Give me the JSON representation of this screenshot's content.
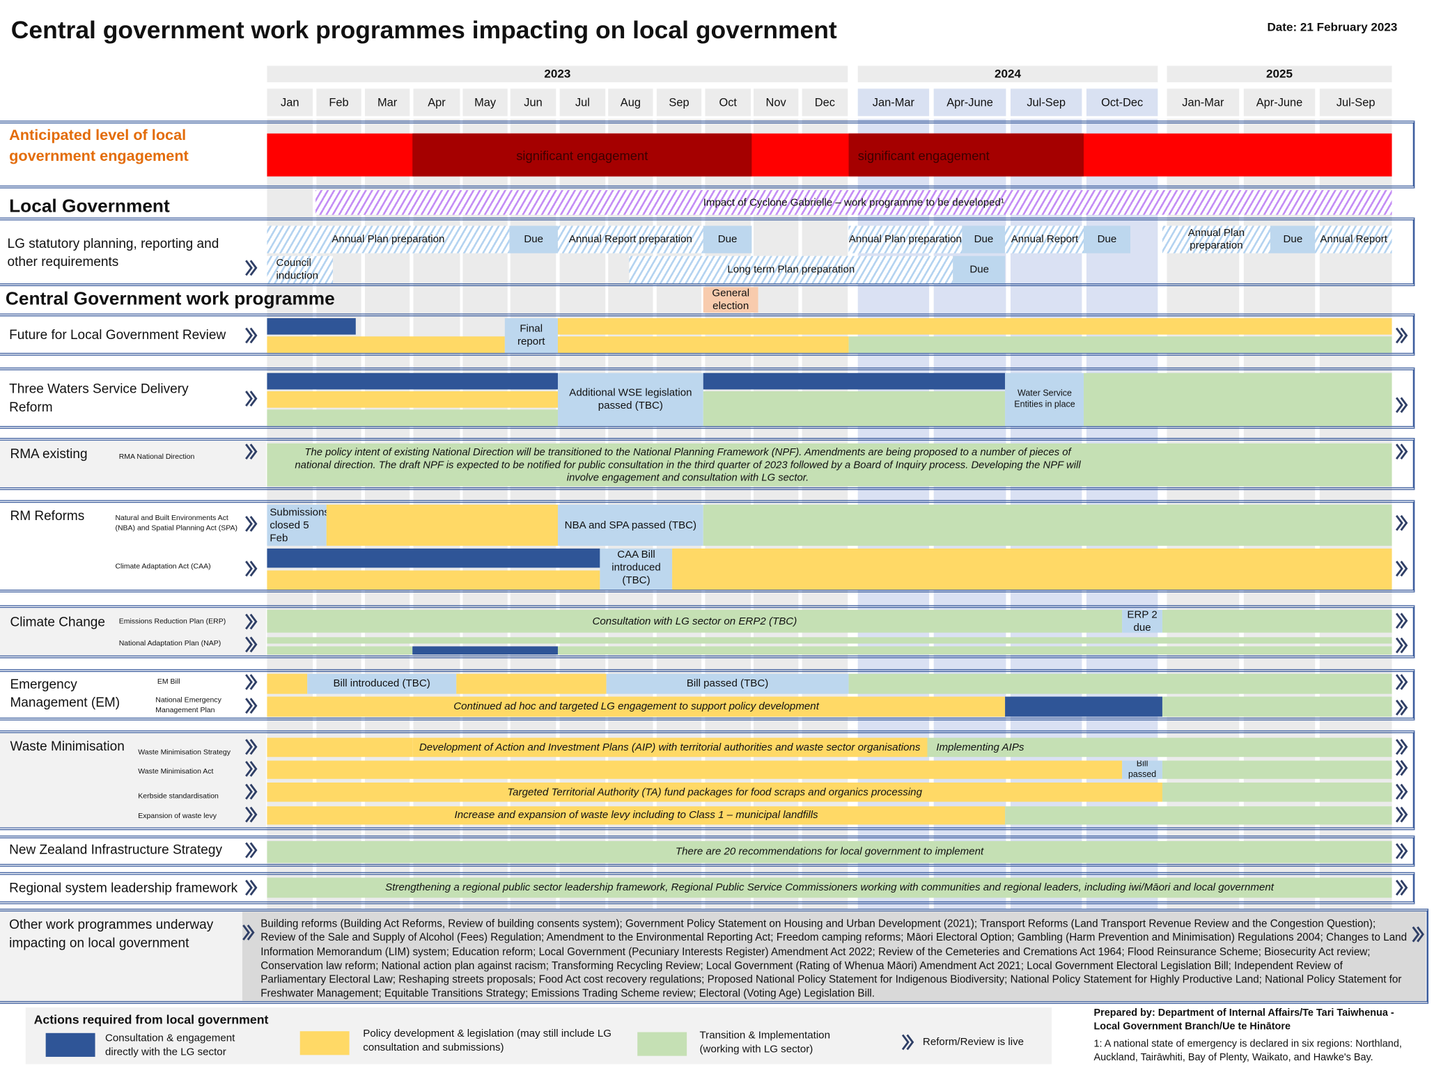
{
  "header": {
    "title": "Central government work programmes impacting on local government",
    "date": "Date: 21 February 2023"
  },
  "timeline": {
    "years": [
      "2023",
      "2024",
      "2025"
    ],
    "columns": [
      "Jan",
      "Feb",
      "Mar",
      "Apr",
      "May",
      "Jun",
      "Jul",
      "Aug",
      "Sep",
      "Oct",
      "Nov",
      "Dec",
      "Jan-Mar",
      "Apr-June",
      "Jul-Sep",
      "Oct-Dec",
      "Jan-Mar",
      "Apr-June",
      "Jul-Sep"
    ]
  },
  "colors": {
    "consultation": "#2f5597",
    "policy": "#ffd966",
    "transition": "#c5e0b4",
    "milestone": "#bdd7ee",
    "high": "#ff0000",
    "significant": "#a50000",
    "election": "#f8cbad",
    "hatch_blue": "#b4d3f0",
    "hatch_purple": "#c48ef5",
    "label_orange": "#e36c09",
    "border": "#3d5e9e",
    "stripe_grey": "#ebebeb",
    "stripe_blue": "#dae1f3"
  },
  "headings": {
    "local_government": "Local Government",
    "central_government": "Central Government work programme"
  },
  "sections": [
    {
      "id": "engagement",
      "label": "Anticipated level of local government engagement",
      "sublabels": [],
      "bars": [
        {
          "track": 0,
          "start": "2023-01-01",
          "end": "2025-10-01",
          "type": "high",
          "label": ""
        },
        {
          "track": 0,
          "start": "2023-04-01",
          "end": "2023-11-01",
          "type": "significant",
          "label": "significant engagement"
        },
        {
          "track": 0,
          "start": "2024-01-01",
          "end": "2024-10-01",
          "type": "significant",
          "label": "significant engagement",
          "align": "left"
        }
      ]
    },
    {
      "id": "cyclone",
      "label": "",
      "sublabels": [],
      "bars": [
        {
          "track": 0,
          "start": "2023-02-01",
          "end": "2025-10-01",
          "type": "hatch_purple",
          "label": "Impact of Cyclone Gabrielle – work programme to be developed¹"
        }
      ]
    },
    {
      "id": "statutory",
      "label": "LG statutory planning, reporting and other requirements",
      "sublabels": [],
      "bars": [
        {
          "track": 0,
          "start": "2023-01-01",
          "end": "2023-06-01",
          "type": "hatch_blue",
          "label": "Annual Plan preparation"
        },
        {
          "track": 0,
          "start": "2023-06-01",
          "end": "2023-07-01",
          "type": "milestone",
          "label": "Due"
        },
        {
          "track": 0,
          "start": "2023-07-01",
          "end": "2023-10-01",
          "type": "hatch_blue",
          "label": "Annual Report preparation"
        },
        {
          "track": 0,
          "start": "2023-10-01",
          "end": "2023-11-01",
          "type": "milestone",
          "label": "Due"
        },
        {
          "track": 0,
          "start": "2024-01-01",
          "end": "2024-05-11",
          "type": "hatch_blue",
          "label": "Annual Plan preparation"
        },
        {
          "track": 0,
          "start": "2024-05-11",
          "end": "2024-07-01",
          "type": "milestone",
          "label": "Due"
        },
        {
          "track": 0,
          "start": "2024-07-01",
          "end": "2024-10-01",
          "type": "hatch_blue",
          "label": "Annual Report"
        },
        {
          "track": 0,
          "start": "2024-10-01",
          "end": "2024-11-24",
          "type": "milestone",
          "label": "Due"
        },
        {
          "track": 0,
          "start": "2025-01-01",
          "end": "2025-05-08",
          "type": "hatch_blue",
          "label": "Annual Plan preparation"
        },
        {
          "track": 0,
          "start": "2025-05-08",
          "end": "2025-07-01",
          "type": "milestone",
          "label": "Due"
        },
        {
          "track": 0,
          "start": "2025-07-01",
          "end": "2025-10-01",
          "type": "hatch_blue",
          "label": "Annual Report"
        },
        {
          "track": 1,
          "start": "2023-01-01",
          "end": "2023-02-12",
          "type": "hatch_blue",
          "label": "Council induction",
          "align": "left"
        },
        {
          "track": 1,
          "start": "2023-08-15",
          "end": "2024-05-01",
          "type": "hatch_blue",
          "label": "Long term Plan preparation"
        },
        {
          "track": 1,
          "start": "2024-05-01",
          "end": "2024-07-01",
          "type": "milestone",
          "label": "Due"
        }
      ]
    },
    {
      "id": "election",
      "label": "",
      "sublabels": [],
      "bars": [
        {
          "track": 0,
          "start": "2023-10-01",
          "end": "2023-11-05",
          "type": "election",
          "label": "General election"
        }
      ]
    },
    {
      "id": "future",
      "label": "Future for Local Government Review",
      "sublabels": [],
      "bars": [
        {
          "track": 0,
          "start": "2023-01-01",
          "end": "2023-02-26",
          "type": "consultation",
          "label": ""
        },
        {
          "track": 1,
          "start": "2023-01-01",
          "end": "2023-05-28",
          "type": "policy",
          "label": ""
        },
        {
          "track": 0,
          "span": 2,
          "start": "2023-05-28",
          "end": "2023-07-01",
          "type": "milestone",
          "label": "Final report"
        },
        {
          "track": 0,
          "start": "2023-07-01",
          "end": "2025-10-01",
          "type": "policy",
          "label": ""
        },
        {
          "track": 1,
          "start": "2023-07-01",
          "end": "2024-01-01",
          "type": "policy",
          "label": ""
        },
        {
          "track": 1,
          "start": "2024-01-01",
          "end": "2025-10-01",
          "type": "transition",
          "label": ""
        }
      ]
    },
    {
      "id": "water",
      "label": "Three Waters Service Delivery Reform",
      "sublabels": [],
      "bars": [
        {
          "track": 0,
          "start": "2023-01-01",
          "end": "2023-07-01",
          "type": "consultation",
          "label": ""
        },
        {
          "track": 1,
          "start": "2023-01-01",
          "end": "2023-07-01",
          "type": "policy",
          "label": ""
        },
        {
          "track": 2,
          "start": "2023-01-01",
          "end": "2023-07-01",
          "type": "transition",
          "label": ""
        },
        {
          "track": 0,
          "span": 3,
          "start": "2023-07-01",
          "end": "2023-10-01",
          "type": "milestone",
          "label": "Additional WSE legislation passed (TBC)"
        },
        {
          "track": 0,
          "start": "2023-10-01",
          "end": "2024-07-01",
          "type": "consultation",
          "label": ""
        },
        {
          "track": 1,
          "span": 2,
          "start": "2023-10-01",
          "end": "2024-07-01",
          "type": "transition",
          "label": ""
        },
        {
          "track": 0,
          "span": 3,
          "start": "2024-07-01",
          "end": "2024-10-01",
          "type": "milestone",
          "label": "Water Service Entities in place",
          "small": true
        },
        {
          "track": 0,
          "span": 3,
          "start": "2024-10-01",
          "end": "2025-10-01",
          "type": "transition",
          "label": ""
        }
      ]
    },
    {
      "id": "rma",
      "label": "RMA existing",
      "sublabels": [
        "RMA National Direction"
      ],
      "bars": [
        {
          "track": 0,
          "start": "2023-01-01",
          "end": "2025-10-01",
          "type": "transition",
          "italic": true,
          "label": "The policy intent of existing National Direction will be transitioned to the National Planning Framework (NPF). Amendments are being proposed to a number of pieces of national direction. The draft NPF is expected to be notified for public consultation in the third quarter of 2023 followed by a Board of Inquiry process. Developing the NPF will involve engagement and consultation with LG sector."
        }
      ]
    },
    {
      "id": "rm",
      "label": "RM Reforms",
      "sublabels": [
        "Natural and Built Environments Act (NBA) and Spatial Planning Act (SPA)",
        "Climate Adaptation Act (CAA)"
      ],
      "bars": [
        {
          "track": 0,
          "start": "2023-01-01",
          "end": "2023-02-08",
          "type": "milestone",
          "label": "Submissions closed 5 Feb",
          "align": "left"
        },
        {
          "track": 0,
          "start": "2023-02-08",
          "end": "2023-07-01",
          "type": "policy",
          "label": ""
        },
        {
          "track": 0,
          "start": "2023-07-01",
          "end": "2023-10-01",
          "type": "milestone",
          "label": "NBA and SPA passed (TBC)"
        },
        {
          "track": 0,
          "start": "2023-10-01",
          "end": "2025-10-01",
          "type": "transition",
          "label": ""
        },
        {
          "track": 1,
          "start": "2023-01-01",
          "end": "2023-07-27",
          "type": "consultation",
          "label": ""
        },
        {
          "track": 2,
          "start": "2023-01-01",
          "end": "2023-07-27",
          "type": "policy",
          "label": ""
        },
        {
          "track": 1,
          "span": 2,
          "start": "2023-07-27",
          "end": "2023-09-12",
          "type": "milestone",
          "label": "CAA Bill introduced (TBC)"
        },
        {
          "track": 1,
          "span": 2,
          "start": "2023-09-12",
          "end": "2025-10-01",
          "type": "policy",
          "label": ""
        }
      ]
    },
    {
      "id": "climate",
      "label": "Climate Change",
      "sublabels": [
        "Emissions Reduction Plan (ERP)",
        "National Adaptation Plan (NAP)"
      ],
      "bars": [
        {
          "track": 0,
          "start": "2023-01-01",
          "end": "2024-11-15",
          "type": "transition",
          "italic": true,
          "label": "Consultation with LG sector on ERP2 (TBC)"
        },
        {
          "track": 0,
          "start": "2024-11-15",
          "end": "2025-01-01",
          "type": "milestone",
          "label": "ERP 2 due"
        },
        {
          "track": 0,
          "start": "2025-01-01",
          "end": "2025-10-01",
          "type": "transition",
          "label": ""
        },
        {
          "track": 1,
          "start": "2023-01-01",
          "end": "2025-10-01",
          "type": "transition",
          "label": ""
        },
        {
          "track": 2,
          "start": "2023-01-01",
          "end": "2023-04-01",
          "type": "transition",
          "label": ""
        },
        {
          "track": 2,
          "start": "2023-04-01",
          "end": "2023-07-01",
          "type": "consultation",
          "label": ""
        },
        {
          "track": 2,
          "start": "2023-07-01",
          "end": "2025-10-01",
          "type": "transition",
          "label": ""
        }
      ]
    },
    {
      "id": "em",
      "label": "Emergency Management (EM)",
      "sublabels": [
        "EM Bill",
        "National Emergency Management Plan"
      ],
      "bars": [
        {
          "track": 0,
          "start": "2023-01-01",
          "end": "2023-01-26",
          "type": "policy",
          "label": ""
        },
        {
          "track": 0,
          "start": "2023-01-26",
          "end": "2023-04-28",
          "type": "milestone",
          "label": "Bill introduced (TBC)"
        },
        {
          "track": 0,
          "start": "2023-04-28",
          "end": "2023-08-01",
          "type": "policy",
          "label": ""
        },
        {
          "track": 0,
          "start": "2023-08-01",
          "end": "2024-01-01",
          "type": "milestone",
          "label": "Bill passed (TBC)"
        },
        {
          "track": 0,
          "start": "2024-01-01",
          "end": "2025-10-01",
          "type": "transition",
          "label": ""
        },
        {
          "track": 1,
          "start": "2023-01-01",
          "end": "2024-07-01",
          "type": "policy",
          "italic": true,
          "label": "Continued ad hoc and targeted LG engagement to support policy development"
        },
        {
          "track": 1,
          "start": "2024-07-01",
          "end": "2025-01-01",
          "type": "consultation",
          "label": ""
        },
        {
          "track": 1,
          "start": "2025-01-01",
          "end": "2025-10-01",
          "type": "transition",
          "label": ""
        }
      ]
    },
    {
      "id": "waste",
      "label": "Waste Minimisation",
      "sublabels": [
        "Waste Minimisation Strategy",
        "Waste Minimisation Act",
        "Kerbside standardisation",
        "Expansion of waste levy"
      ],
      "bars": [
        {
          "track": 0,
          "start": "2023-01-01",
          "end": "2023-04-01",
          "type": "policy",
          "label": ""
        },
        {
          "track": 0,
          "start": "2023-04-01",
          "end": "2024-04-01",
          "type": "policy",
          "italic": true,
          "label": "Development of Action and Investment Plans (AIP) with territorial authorities and waste sector organisations"
        },
        {
          "track": 0,
          "start": "2024-04-01",
          "end": "2025-10-01",
          "type": "transition",
          "italic": true,
          "label": "Implementing AIPs",
          "align": "left"
        },
        {
          "track": 1,
          "start": "2023-01-01",
          "end": "2024-11-15",
          "type": "policy",
          "label": ""
        },
        {
          "track": 1,
          "start": "2024-11-15",
          "end": "2025-01-01",
          "type": "milestone",
          "label": "Bill passed",
          "small": true
        },
        {
          "track": 1,
          "start": "2025-01-01",
          "end": "2025-10-01",
          "type": "transition",
          "label": ""
        },
        {
          "track": 2,
          "start": "2023-01-01",
          "end": "2025-01-01",
          "type": "policy",
          "italic": true,
          "label": "Targeted Territorial Authority (TA) fund packages for food scraps and organics processing"
        },
        {
          "track": 2,
          "start": "2025-01-01",
          "end": "2025-10-01",
          "type": "transition",
          "label": ""
        },
        {
          "track": 3,
          "start": "2023-01-01",
          "end": "2024-07-01",
          "type": "policy",
          "italic": true,
          "label": "Increase and expansion of waste levy including to Class 1 – municipal landfills"
        },
        {
          "track": 3,
          "start": "2024-07-01",
          "end": "2025-10-01",
          "type": "transition",
          "label": ""
        }
      ]
    },
    {
      "id": "nzis",
      "label": "New Zealand Infrastructure Strategy",
      "sublabels": [],
      "bars": [
        {
          "track": 0,
          "start": "2023-01-01",
          "end": "2025-10-01",
          "type": "transition",
          "italic": true,
          "label": "There are 20 recommendations for local government to implement"
        }
      ]
    },
    {
      "id": "regional",
      "label": "Regional system leadership framework",
      "sublabels": [],
      "bars": [
        {
          "track": 0,
          "start": "2023-01-01",
          "end": "2025-10-01",
          "type": "transition",
          "italic": true,
          "label": "Strengthening a regional public sector leadership framework, Regional Public Service Commissioners working with communities and regional leaders, including iwi/Māori and local government"
        }
      ]
    }
  ],
  "other": {
    "label": "Other work programmes underway impacting on local government",
    "text": "Building reforms (Building Act Reforms, Review of building consents system); Government Policy Statement on Housing and Urban Development (2021); Transport Reforms (Land Transport Revenue Review and the Congestion Question); Review of the Sale and Supply of Alcohol (Fees) Regulation; Amendment to the Environmental Reporting Act; Freedom camping reforms;  Māori Electoral Option; Gambling (Harm Prevention and Minimisation) Regulations 2004; Changes to Land Information Memorandum (LIM) system;  Education reform; Local Government (Pecuniary Interests Register) Amendment Act 2022; Review of the Cemeteries and Cremations Act 1964; Flood Reinsurance Scheme; Biosecurity Act review; Conservation law reform; National action plan against racism; Transforming Recycling Review; Local Government (Rating of Whenua Māori) Amendment Act 2021; Local Government Electoral Legislation Bill; Independent Review of Parliamentary Electoral Law; Reshaping streets proposals; Food Act cost recovery regulations; Proposed National Policy Statement for Indigenous Biodiversity; National Policy Statement for Highly Productive Land; National Policy Statement for Freshwater Management; Equitable Transitions Strategy; Emissions Trading Scheme review; Electoral (Voting Age) Legislation Bill."
  },
  "legend": {
    "title": "Actions required from local government",
    "consultation": "Consultation & engagement directly with the LG sector",
    "policy": "Policy development & legislation (may still include LG consultation and submissions)",
    "transition": "Transition & Implementation (working with LG sector)",
    "live": "Reform/Review is live"
  },
  "footer": {
    "prepared_by": "Prepared by: Department of Internal Affairs/Te Tari Taiwhenua - Local Government Branch/Ue te Hinātore",
    "footnote": "1: A national state of emergency is declared in six regions: Northland, Auckland, Tairāwhiti, Bay of Plenty, Waikato, and Hawke's Bay."
  }
}
